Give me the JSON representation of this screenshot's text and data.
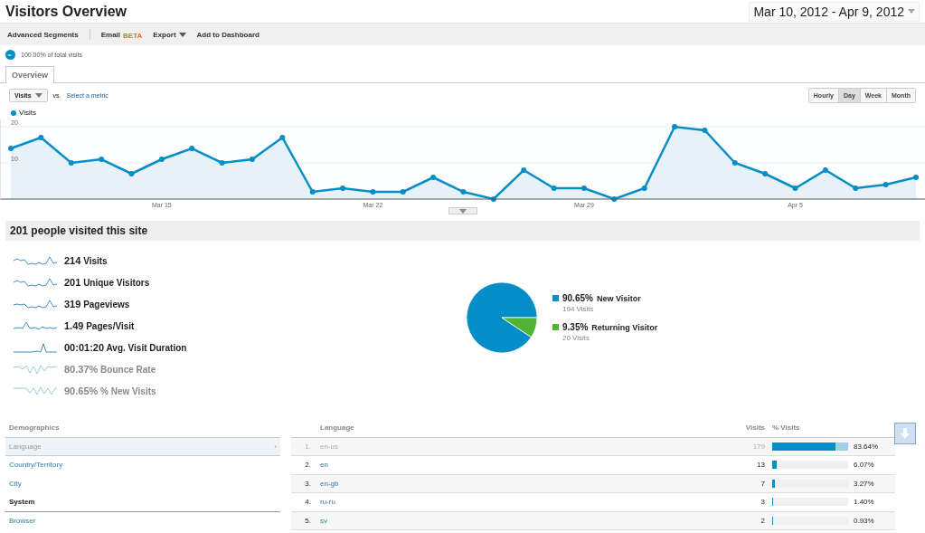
{
  "header": {
    "title": "Visitors Overview",
    "date_range": "Mar 10, 2012 - Apr 9, 2012"
  },
  "toolbar": [
    {
      "label": "Advanced Segments",
      "kind": "plain"
    },
    {
      "label": "Email",
      "badge": "BETA",
      "kind": "badge"
    },
    {
      "label": "Export",
      "kind": "menu"
    },
    {
      "label": "Add to Dashboard",
      "kind": "plain"
    }
  ],
  "segment": {
    "label": "100.00% of total visits"
  },
  "tabs": [
    {
      "label": "Overview",
      "selected": true
    }
  ],
  "chart_controls": {
    "metric": "Visits",
    "vs": "vs.",
    "compare_link": "Select a metric",
    "granularity": [
      {
        "label": "Hourly",
        "selected": false
      },
      {
        "label": "Day",
        "selected": true
      },
      {
        "label": "Week",
        "selected": false
      },
      {
        "label": "Month",
        "selected": false
      }
    ]
  },
  "chart_data": {
    "type": "area",
    "series": [
      {
        "name": "Visits",
        "color": "#058dc7",
        "values": [
          14,
          17,
          10,
          11,
          7,
          11,
          14,
          10,
          11,
          17,
          2,
          3,
          2,
          2,
          6,
          2,
          0,
          8,
          3,
          3,
          0,
          3,
          20,
          19,
          10,
          7,
          3,
          8,
          3,
          4,
          6
        ]
      }
    ],
    "categories": [
      null,
      null,
      null,
      null,
      null,
      "Mar 15",
      null,
      null,
      null,
      null,
      null,
      null,
      "Mar 22",
      null,
      null,
      null,
      null,
      null,
      null,
      "Mar 29",
      null,
      null,
      null,
      null,
      null,
      null,
      "Apr 5",
      null,
      null,
      null,
      null
    ],
    "yticks": [
      10,
      20
    ],
    "ylim": [
      0,
      22
    ]
  },
  "summary": {
    "title": "201 people visited this site",
    "metrics": [
      {
        "value": "214",
        "label": "Visits",
        "dimmed": false
      },
      {
        "value": "201",
        "label": "Unique Visitors",
        "dimmed": false
      },
      {
        "value": "319",
        "label": "Pageviews",
        "dimmed": false
      },
      {
        "value": "1.49",
        "label": "Pages/Visit",
        "dimmed": false
      },
      {
        "value": "00:01:20",
        "label": "Avg. Visit Duration",
        "dimmed": false
      },
      {
        "value": "80.37%",
        "label": "Bounce Rate",
        "dimmed": true
      },
      {
        "value": "90.65%",
        "label": "% New Visits",
        "dimmed": true
      }
    ],
    "pie": {
      "chart_data": {
        "type": "pie",
        "categories": [
          "New Visitor",
          "Returning Visitor"
        ],
        "values": [
          90.65,
          9.35
        ],
        "colors": [
          "#058dc7",
          "#50b432"
        ]
      },
      "legend": [
        {
          "percent": "90.65%",
          "visits": "194 Visits"
        },
        {
          "percent": "9.35%",
          "visits": "20 Visits"
        }
      ]
    }
  },
  "nav": [
    {
      "kind": "header",
      "label": "Demographics",
      "selected": false
    },
    {
      "kind": "link",
      "label": "Language",
      "selected": true,
      "arrow": "›"
    },
    {
      "kind": "link",
      "label": "Country/Territory",
      "selected": false
    },
    {
      "kind": "link",
      "label": "City",
      "selected": false
    },
    {
      "kind": "section",
      "label": "System",
      "selected": false
    },
    {
      "kind": "link",
      "label": "Browser",
      "selected": false
    }
  ],
  "table": {
    "columns": [
      "Language",
      "Visits",
      "% Visits"
    ],
    "rows": [
      {
        "rank": "1.",
        "language": "en-us",
        "visits": "179",
        "level": 0.8364,
        "percent": "83.64%",
        "selected": true
      },
      {
        "rank": "2.",
        "language": "en",
        "visits": "13",
        "level": 0.0607,
        "percent": "6.07%",
        "selected": false
      },
      {
        "rank": "3.",
        "language": "en-gb",
        "visits": "7",
        "level": 0.0327,
        "percent": "3.27%",
        "selected": false
      },
      {
        "rank": "4.",
        "language": "ru-ru",
        "visits": "3",
        "level": 0.014,
        "percent": "1.40%",
        "selected": false
      },
      {
        "rank": "5.",
        "language": "sv",
        "visits": "2",
        "level": 0.0093,
        "percent": "0.93%",
        "selected": false
      }
    ]
  }
}
